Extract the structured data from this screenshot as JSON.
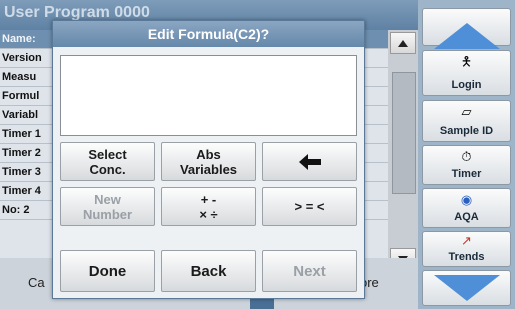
{
  "background": {
    "title": "User Program   0000",
    "rows": [
      "Name:",
      "Version",
      "Measu",
      "Formul",
      "Variabl",
      "Timer 1",
      "Timer 2",
      "Timer 3",
      "Timer 4",
      "No: 2"
    ],
    "bottom_left": "Ca",
    "bottom_right": "ore"
  },
  "sidebar": {
    "login": "Login",
    "sample_id": "Sample ID",
    "timer": "Timer",
    "aqa": "AQA",
    "trends": "Trends"
  },
  "dialog": {
    "title": "Edit Formula(C2)?",
    "formula_value": "",
    "keys": {
      "select_conc_1": "Select",
      "select_conc_2": "Conc.",
      "abs_var_1": "Abs",
      "abs_var_2": "Variables",
      "backspace": "🡄",
      "new_number_1": "New",
      "new_number_2": "Number",
      "ops_1": "+ -",
      "ops_2": "× ÷",
      "compare": "> = <"
    },
    "done": "Done",
    "back": "Back",
    "next": "Next"
  },
  "colors": {
    "accent": "#4f8fd8",
    "title_bar": "#6688aa"
  }
}
